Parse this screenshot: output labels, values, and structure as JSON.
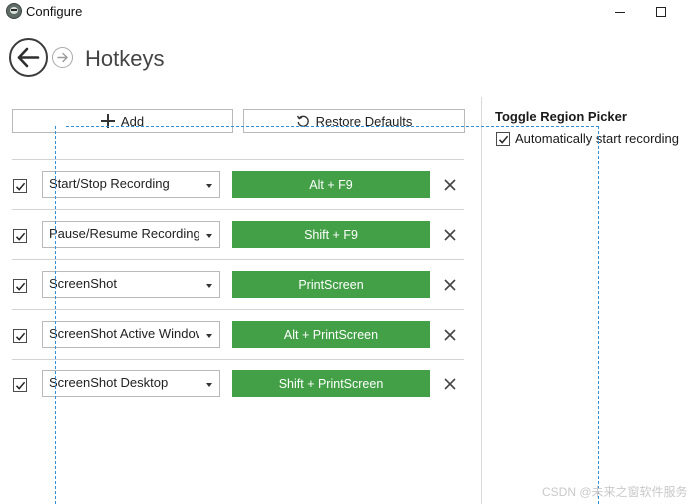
{
  "window": {
    "title": "Configure",
    "icon": "app-avatar-icon"
  },
  "header": {
    "title": "Hotkeys",
    "back_icon": "arrow-left-icon",
    "forward_icon": "arrow-right-icon"
  },
  "toolbar": {
    "add_label": "Add",
    "restore_label": "Restore Defaults",
    "add_icon": "plus-icon",
    "restore_icon": "restore-icon"
  },
  "hotkeys": [
    {
      "enabled": true,
      "action": "Start/Stop Recording",
      "keys": "Alt + F9"
    },
    {
      "enabled": true,
      "action": "Pause/Resume Recording",
      "keys": "Shift + F9"
    },
    {
      "enabled": true,
      "action": "ScreenShot",
      "keys": "PrintScreen"
    },
    {
      "enabled": true,
      "action": "ScreenShot Active Window",
      "keys": "Alt + PrintScreen"
    },
    {
      "enabled": true,
      "action": "ScreenShot Desktop",
      "keys": "Shift + PrintScreen"
    }
  ],
  "side_panel": {
    "heading": "Toggle Region Picker",
    "option_label": "Automatically start recording",
    "option_checked": true
  },
  "watermark": "CSDN @未来之窗软件服务",
  "colors": {
    "hotkey_button": "#43a047",
    "guide_line": "#2f8fd8"
  }
}
